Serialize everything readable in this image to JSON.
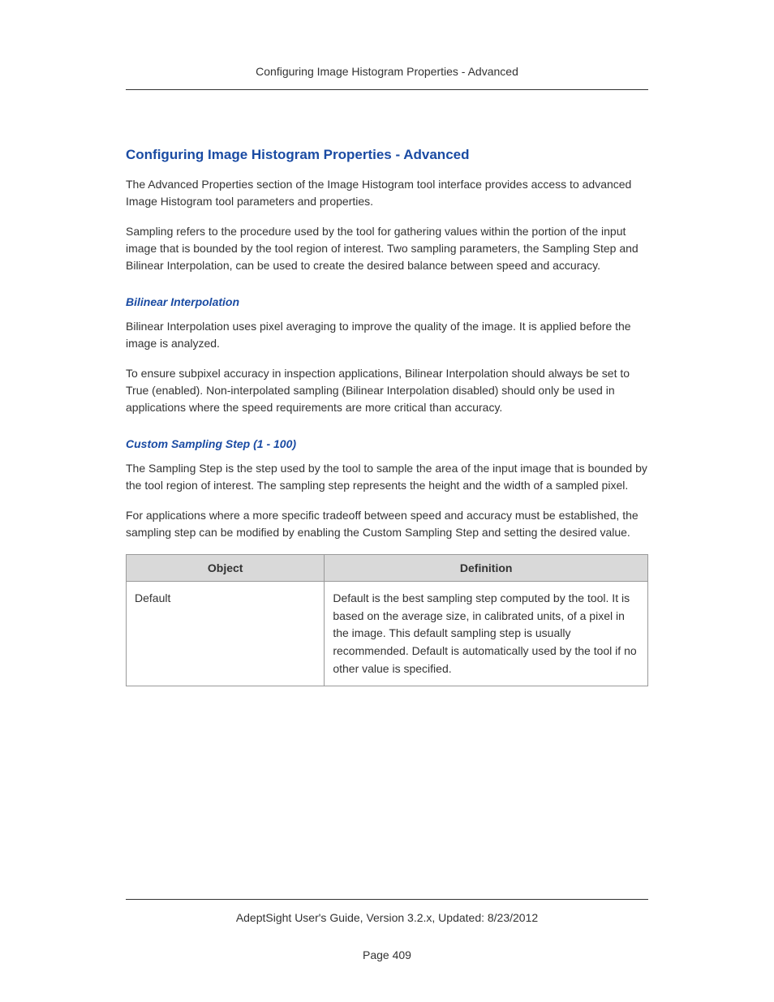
{
  "header": {
    "running_title": "Configuring Image Histogram Properties - Advanced"
  },
  "title": "Configuring Image Histogram Properties - Advanced",
  "paragraphs": {
    "intro1": "The Advanced Properties section of the Image Histogram tool interface provides access to advanced Image Histogram tool parameters and properties.",
    "intro2": "Sampling refers to the procedure used by the tool for gathering values within the portion of the input image that is bounded by the tool region of interest. Two sampling parameters, the Sampling Step and Bilinear Interpolation, can be used to create the desired balance between speed and accuracy."
  },
  "sections": {
    "bilinear": {
      "heading": "Bilinear Interpolation",
      "p1": "Bilinear Interpolation uses pixel averaging to improve the quality of the image. It is applied before the image is analyzed.",
      "p2": "To ensure subpixel accuracy in inspection applications, Bilinear Interpolation should always be set to True (enabled). Non-interpolated sampling (Bilinear Interpolation disabled) should only be used in applications where the speed requirements are more critical than accuracy."
    },
    "sampling": {
      "heading": "Custom Sampling Step (1 - 100)",
      "p1": "The Sampling Step is the step used by the tool to sample the area of the input image that is bounded by the tool region of interest. The sampling step represents the height and the width of a sampled pixel.",
      "p2": "For applications where a more specific tradeoff between speed and accuracy must be established, the sampling step can be modified by enabling the Custom Sampling Step and setting the desired value."
    }
  },
  "table": {
    "headers": {
      "object": "Object",
      "definition": "Definition"
    },
    "rows": [
      {
        "object": "Default",
        "definition": "Default is the best sampling step computed by the tool. It is based on the average size, in calibrated units, of a pixel in the image. This default sampling step is usually recommended. Default is automatically used by the tool if no other value is specified."
      }
    ]
  },
  "footer": {
    "line1": "AdeptSight User's Guide,  Version 3.2.x, Updated: 8/23/2012",
    "line2": "Page 409"
  }
}
